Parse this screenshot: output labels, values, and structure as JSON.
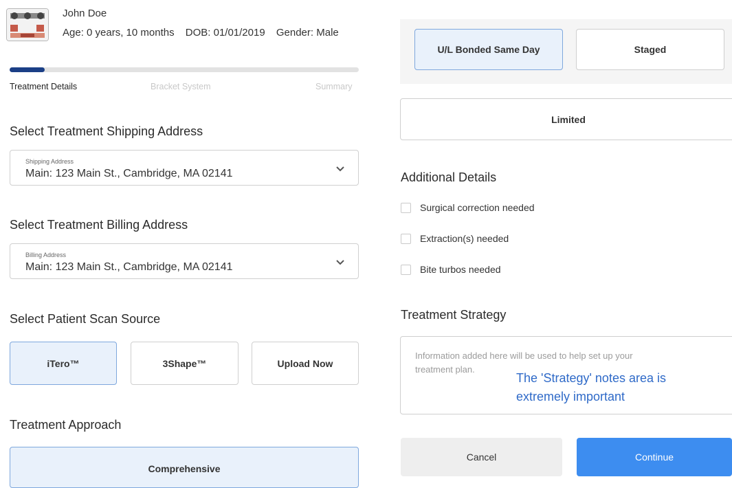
{
  "patient": {
    "name": "John Doe",
    "age": "Age: 0 years, 10 months",
    "dob": "DOB: 01/01/2019",
    "gender": "Gender: Male"
  },
  "progress": {
    "fraction": 0.1,
    "steps": [
      "Treatment Details",
      "Bracket System",
      "Summary"
    ],
    "current_step": "Treatment Details"
  },
  "shipping": {
    "heading": "Select Treatment Shipping Address",
    "field_label": "Shipping Address",
    "value": "Main: 123 Main St., Cambridge, MA 02141"
  },
  "billing": {
    "heading": "Select Treatment Billing Address",
    "field_label": "Billing Address",
    "value": "Main: 123 Main St., Cambridge, MA 02141"
  },
  "scan_source": {
    "heading": "Select Patient Scan Source",
    "options": [
      "iTero™",
      "3Shape™",
      "Upload Now"
    ],
    "selected": "iTero™"
  },
  "treatment_approach": {
    "heading": "Treatment Approach",
    "options": [
      "Comprehensive",
      "U/L Bonded Same Day",
      "Staged",
      "Limited"
    ],
    "selected": [
      "Comprehensive",
      "U/L Bonded Same Day"
    ]
  },
  "additional_details": {
    "heading": "Additional Details",
    "items": [
      "Surgical correction needed",
      "Extraction(s) needed",
      "Bite turbos needed"
    ]
  },
  "strategy": {
    "heading": "Treatment Strategy",
    "placeholder": "Information added here will be used to help set up your treatment plan.",
    "annotation": "The 'Strategy' notes area is extremely important"
  },
  "actions": {
    "cancel": "Cancel",
    "continue": "Continue"
  },
  "colors": {
    "progress": "#1b3f86",
    "selected_bg": "#e9f1fb",
    "selected_border": "#7ea7dd",
    "continue_bg": "#3d8df0",
    "annotation": "#2f6ac8"
  }
}
